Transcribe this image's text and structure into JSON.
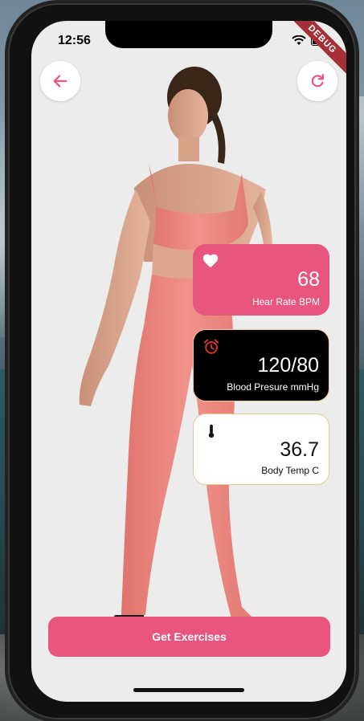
{
  "status_bar": {
    "time": "12:56"
  },
  "debug_banner": "DEBUG",
  "header": {
    "back_icon": "arrow-left-icon",
    "refresh_icon": "refresh-icon"
  },
  "vitals": [
    {
      "icon": "heart-icon",
      "value": "68",
      "label": "Hear Rate BPM"
    },
    {
      "icon": "alarm-clock-icon",
      "value": "120/80",
      "label": "Blood Presure mmHg"
    },
    {
      "icon": "thermometer-icon",
      "value": "36.7",
      "label": "Body Temp C"
    }
  ],
  "cta": {
    "label": "Get Exercises"
  },
  "colors": {
    "accent": "#e8557f",
    "card_dark": "#000000",
    "card_light": "#ffffff",
    "card_border": "#e9c98f",
    "alarm_icon": "#e2342c",
    "screen_bg": "#ececec"
  }
}
